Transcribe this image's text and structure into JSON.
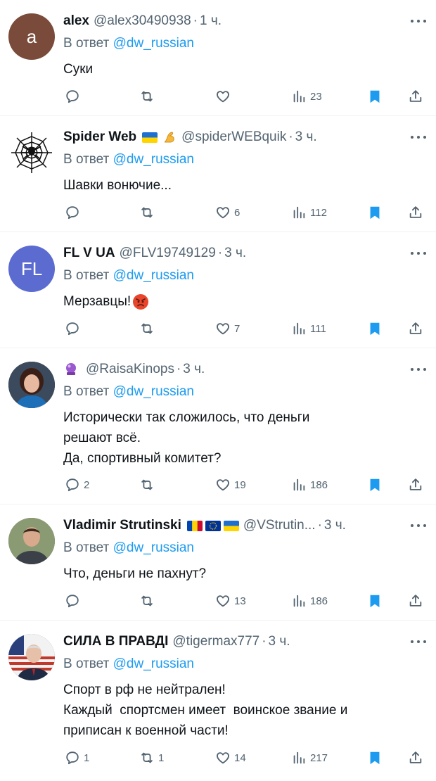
{
  "common": {
    "in_reply_prefix": "В ответ",
    "in_reply_mention": "@dw_russian",
    "separator": "·"
  },
  "colors": {
    "accent": "#1d9bf0",
    "secondary_text": "#536471",
    "bookmark": "#1d9bf0"
  },
  "replies": [
    {
      "name": "alex",
      "handle": "@alex30490938",
      "time": "1 ч.",
      "avatar_letter": "a",
      "avatar_color": "#7a4b3a",
      "text": "Суки",
      "replies_count": "",
      "retweets_count": "",
      "likes_count": "",
      "views_count": "23"
    },
    {
      "name": "Spider Web",
      "handle": "@spiderWEBquik",
      "time": "3 ч.",
      "badges": [
        "flag-ukraine",
        "flexed-biceps-emoji"
      ],
      "avatar_icon": "spider-web-icon",
      "text": "Шавки вонючие...",
      "replies_count": "",
      "retweets_count": "",
      "likes_count": "6",
      "views_count": "112"
    },
    {
      "name": "FL V UA",
      "handle": "@FLV19749129",
      "time": "3 ч.",
      "avatar_letter": "FL",
      "avatar_color": "#5b6bd0",
      "text": "Мерзавцы!",
      "text_emoji": "angry-face-emoji",
      "replies_count": "",
      "retweets_count": "",
      "likes_count": "7",
      "views_count": "111"
    },
    {
      "name": "",
      "handle": "@RaisaKinops",
      "time": "3 ч.",
      "badges": [
        "crystal-ball-emoji"
      ],
      "avatar_icon": "photo-woman-avatar",
      "text": "Исторически так сложилось, что деньги\nрешают всё.\nДа, спортивный комитет?",
      "replies_count": "2",
      "retweets_count": "",
      "likes_count": "19",
      "views_count": "186"
    },
    {
      "name": "Vladimir Strutinski",
      "handle": "@VStrutin...",
      "time": "3 ч.",
      "badges": [
        "flag-moldova",
        "flag-eu",
        "flag-ukraine"
      ],
      "avatar_icon": "photo-man-avatar",
      "text": "Что, деньги не пахнут?",
      "replies_count": "",
      "retweets_count": "",
      "likes_count": "13",
      "views_count": "186"
    },
    {
      "name": "СИЛА В ПРАВДІ",
      "handle": "@tigermax777",
      "time": "3 ч.",
      "avatar_icon": "photo-man-flag-avatar",
      "text": "Спорт в рф не нейтрален!\nКаждый  спортсмен имеет  воинское звание и\nприписан к военной части!",
      "replies_count": "1",
      "retweets_count": "1",
      "likes_count": "14",
      "views_count": "217"
    }
  ]
}
